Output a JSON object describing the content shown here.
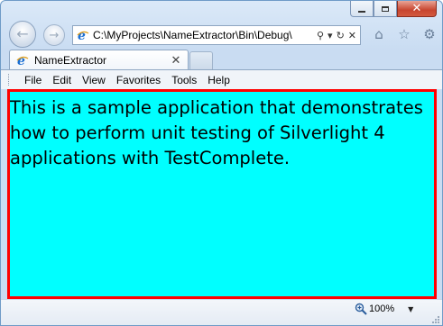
{
  "window": {
    "caption_buttons": {
      "minimize": "minimize",
      "maximize": "maximize",
      "close": "✕"
    }
  },
  "nav": {
    "back_icon": "←",
    "forward_icon": "→",
    "address": "C:\\MyProjects\\NameExtractor\\Bin\\Debug\\",
    "address_icons": {
      "search": "⚲",
      "dropdown": "▾",
      "refresh": "↻",
      "stop": "✕"
    },
    "right_icons": {
      "home": "⌂",
      "favorites": "☆",
      "tools": "⚙"
    }
  },
  "tab": {
    "label": "NameExtractor",
    "close": "✕"
  },
  "menu": {
    "items": [
      "File",
      "Edit",
      "View",
      "Favorites",
      "Tools",
      "Help"
    ]
  },
  "content": {
    "lines": [
      "This is a sample application that demonstrates",
      "how to perform unit testing of Silverlight 4",
      "applications with TestComplete."
    ]
  },
  "status": {
    "zoom": "100%",
    "zoom_dropdown": "▼"
  },
  "colors": {
    "content_bg": "#00ffff",
    "content_border": "#ff0000",
    "close_button": "#c7452f",
    "ie_logo": "#1b6fd2"
  },
  "icons": {
    "ie": "ie-logo-icon",
    "zoom": "zoom-magnifier-icon"
  }
}
